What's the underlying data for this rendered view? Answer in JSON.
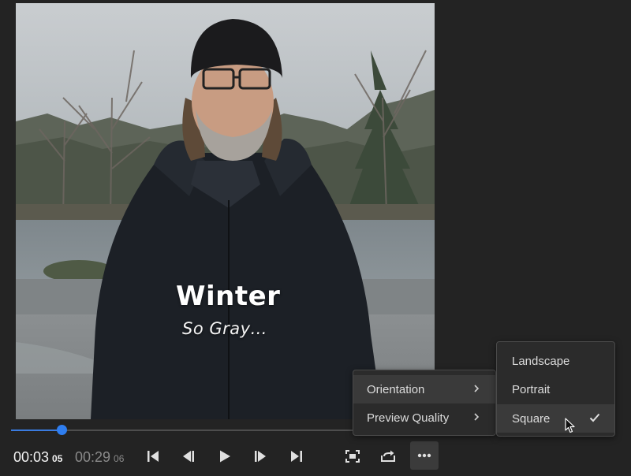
{
  "preview": {
    "title": "Winter",
    "subtitle": "So Gray…"
  },
  "timeline": {
    "progress_fraction": 0.146
  },
  "transport": {
    "current_time": "00:03",
    "current_frames": "05",
    "total_time": "00:29",
    "total_frames": "06"
  },
  "icons": {
    "controls": [
      "go-to-start-icon",
      "step-back-icon",
      "play-icon",
      "step-forward-icon",
      "go-to-end-icon"
    ],
    "tools": [
      "fit-frame-icon",
      "export-share-icon",
      "more-options-icon"
    ]
  },
  "menu": {
    "items": [
      {
        "label": "Orientation",
        "has_submenu": true,
        "highlighted": true
      },
      {
        "label": "Preview Quality",
        "has_submenu": true,
        "highlighted": false
      }
    ]
  },
  "orientation_menu": {
    "items": [
      {
        "label": "Landscape",
        "checked": false
      },
      {
        "label": "Portrait",
        "checked": false
      },
      {
        "label": "Square",
        "checked": true
      }
    ]
  },
  "colors": {
    "background": "#232323",
    "accent": "#2f7ef0",
    "menu_bg": "#2b2b2b",
    "menu_highlight": "#3a3a3a"
  }
}
